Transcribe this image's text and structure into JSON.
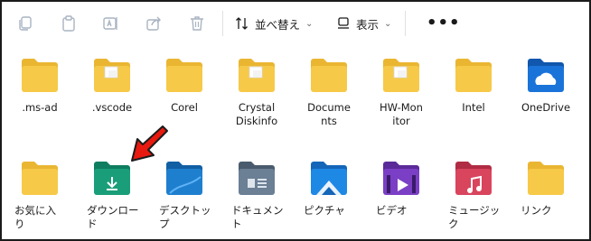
{
  "toolbar": {
    "sort_label": "並べ替え",
    "view_label": "表示",
    "more_label": "•••"
  },
  "items": [
    {
      "name": "folder-ms-ad",
      "line1": ".ms-ad",
      "line2": ""
    },
    {
      "name": "folder-vscode",
      "line1": ".vscode",
      "line2": ""
    },
    {
      "name": "folder-corel",
      "line1": "Corel",
      "line2": ""
    },
    {
      "name": "folder-crystal-diskinfo",
      "line1": "Crystal",
      "line2": "Diskinfo"
    },
    {
      "name": "folder-documents",
      "line1": "Docume",
      "line2": "nts"
    },
    {
      "name": "folder-hw-monitor",
      "line1": "HW-Mon",
      "line2": "itor"
    },
    {
      "name": "folder-intel",
      "line1": "Intel",
      "line2": ""
    },
    {
      "name": "folder-onedrive",
      "line1": "OneDrive",
      "line2": ""
    },
    {
      "name": "folder-favorites",
      "line1": "お気に入",
      "line2": "り"
    },
    {
      "name": "folder-downloads",
      "line1": "ダウンロー",
      "line2": "ド"
    },
    {
      "name": "folder-desktop",
      "line1": "デスクトッ",
      "line2": "プ"
    },
    {
      "name": "folder-documents-jp",
      "line1": "ドキュメン",
      "line2": "ト"
    },
    {
      "name": "folder-pictures",
      "line1": "ピクチャ",
      "line2": ""
    },
    {
      "name": "folder-videos",
      "line1": "ビデオ",
      "line2": ""
    },
    {
      "name": "folder-music",
      "line1": "ミュージッ",
      "line2": "ク"
    },
    {
      "name": "folder-links",
      "line1": "リンク",
      "line2": ""
    }
  ],
  "colors": {
    "folder": "#f7c948",
    "folder_back": "#eab632",
    "downloads": "#1a9e7a",
    "desktop": "#1f7fcf",
    "documents": "#6b7f95",
    "pictures": "#1e88e5",
    "videos": "#7b3fc5",
    "music": "#d8455c",
    "onedrive": "#1a73d9",
    "arrow": "#e8190f"
  }
}
